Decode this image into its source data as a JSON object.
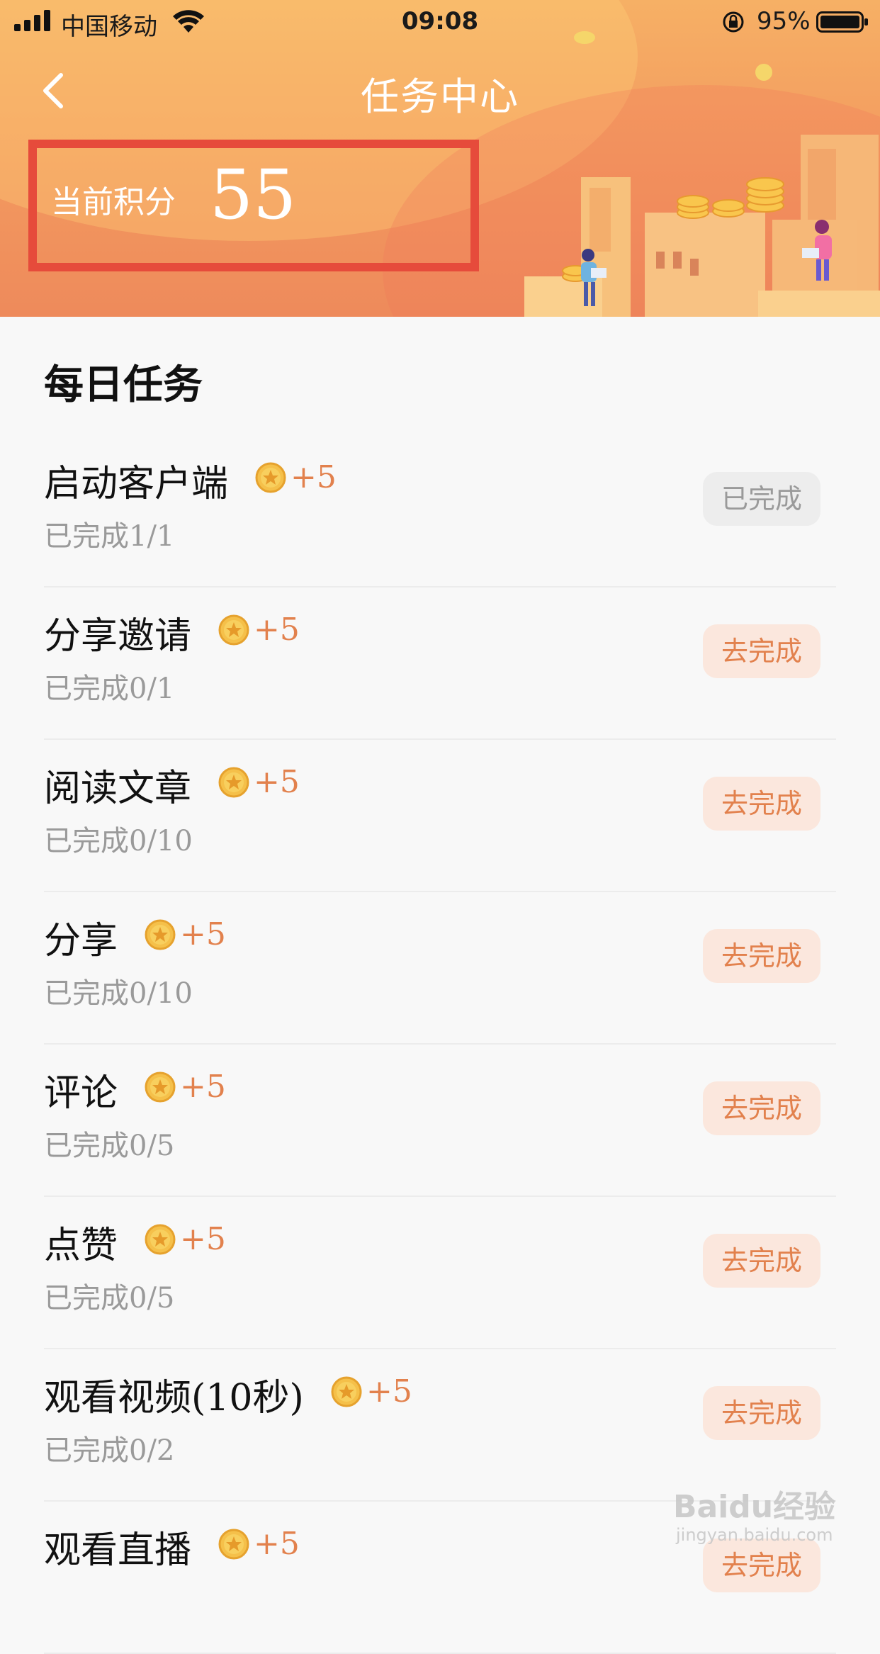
{
  "status_bar": {
    "carrier": "中国移动",
    "time": "09:08",
    "battery_pct": "95%"
  },
  "header": {
    "title": "任务中心",
    "points_label": "当前积分",
    "points_value": "55"
  },
  "section": {
    "title": "每日任务"
  },
  "tasks": [
    {
      "name": "启动客户端",
      "reward": "+5",
      "progress": "已完成1/1",
      "button": "已完成",
      "done": true
    },
    {
      "name": "分享邀请",
      "reward": "+5",
      "progress": "已完成0/1",
      "button": "去完成",
      "done": false
    },
    {
      "name": "阅读文章",
      "reward": "+5",
      "progress": "已完成0/10",
      "button": "去完成",
      "done": false
    },
    {
      "name": "分享",
      "reward": "+5",
      "progress": "已完成0/10",
      "button": "去完成",
      "done": false
    },
    {
      "name": "评论",
      "reward": "+5",
      "progress": "已完成0/5",
      "button": "去完成",
      "done": false
    },
    {
      "name": "点赞",
      "reward": "+5",
      "progress": "已完成0/5",
      "button": "去完成",
      "done": false
    },
    {
      "name": "观看视频(10秒)",
      "reward": "+5",
      "progress": "已完成0/2",
      "button": "去完成",
      "done": false
    },
    {
      "name": "观看直播",
      "reward": "+5",
      "progress": "",
      "button": "去完成",
      "done": false
    }
  ],
  "watermark": {
    "logo": "Baidu经验",
    "url": "jingyan.baidu.com"
  },
  "colors": {
    "accent": "#e2814d",
    "highlight_box": "#e64b3b",
    "hero_top": "#f6b065",
    "hero_bottom": "#ee8a5b"
  }
}
